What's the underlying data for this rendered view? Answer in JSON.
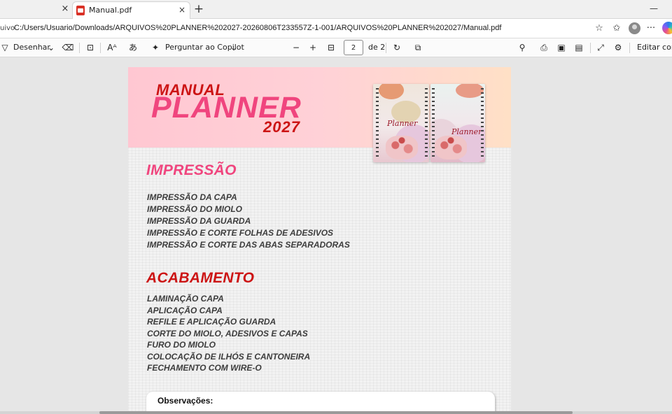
{
  "browser": {
    "tabs": [
      {
        "title": "Manual.pdf",
        "active": true
      }
    ],
    "address": {
      "prefix": "uivo",
      "url": "C:/Users/Usuario/Downloads/ARQUIVOS%20PLANNER%202027-20260806T233557Z-1-001/ARQUIVOS%20PLANNER%202027/Manual.pdf"
    }
  },
  "pdf_toolbar": {
    "draw_label": "Desenhar",
    "copilot_label": "Perguntar ao Copilot",
    "page_current": "2",
    "page_total_label": "de 2",
    "edit_label": "Editar com o"
  },
  "document": {
    "banner": {
      "title_top": "MANUAL",
      "title_main": "PLANNER",
      "title_year": "2027",
      "mockup_script": "Planner"
    },
    "sections": [
      {
        "heading": "IMPRESSÃO",
        "color": "#f0457e",
        "items": [
          "IMPRESSÃO DA CAPA",
          "IMPRESSÃO DO MIOLO",
          "IMPRESSÃO DA GUARDA",
          "IMPRESSÃO E CORTE FOLHAS DE ADESIVOS",
          "IMPRESSÃO E CORTE DAS ABAS SEPARADORAS"
        ]
      },
      {
        "heading": "ACABAMENTO",
        "color": "#cc1414",
        "items": [
          "LAMINAÇÃO CAPA",
          "APLICAÇÃO CAPA",
          "REFILE E APLICAÇÃO GUARDA",
          "CORTE DO MIOLO, ADESIVOS E CAPAS",
          "FURO DO MIOLO",
          "COLOCAÇÃO DE ILHÓS E CANTONEIRA",
          "FECHAMENTO COM WIRE-O"
        ]
      }
    ],
    "notes_label": "Observações:"
  },
  "icons": {
    "close": "×",
    "new_tab": "+",
    "minimize": "—",
    "star": "☆",
    "favorites": "✩",
    "more": "···",
    "draw": "▽",
    "chevron": "⌄",
    "eraser": "⌫",
    "text_box": "⊡",
    "read_aloud": "Aᴬ",
    "translate": "あ",
    "zoom_out": "−",
    "zoom_in": "+",
    "fit": "⊟",
    "rotate": "↻",
    "page_view": "⧉",
    "search": "⚲",
    "print": "⎙",
    "save": "▣",
    "save_as": "▤",
    "expand": "⤢",
    "settings": "⚙"
  }
}
